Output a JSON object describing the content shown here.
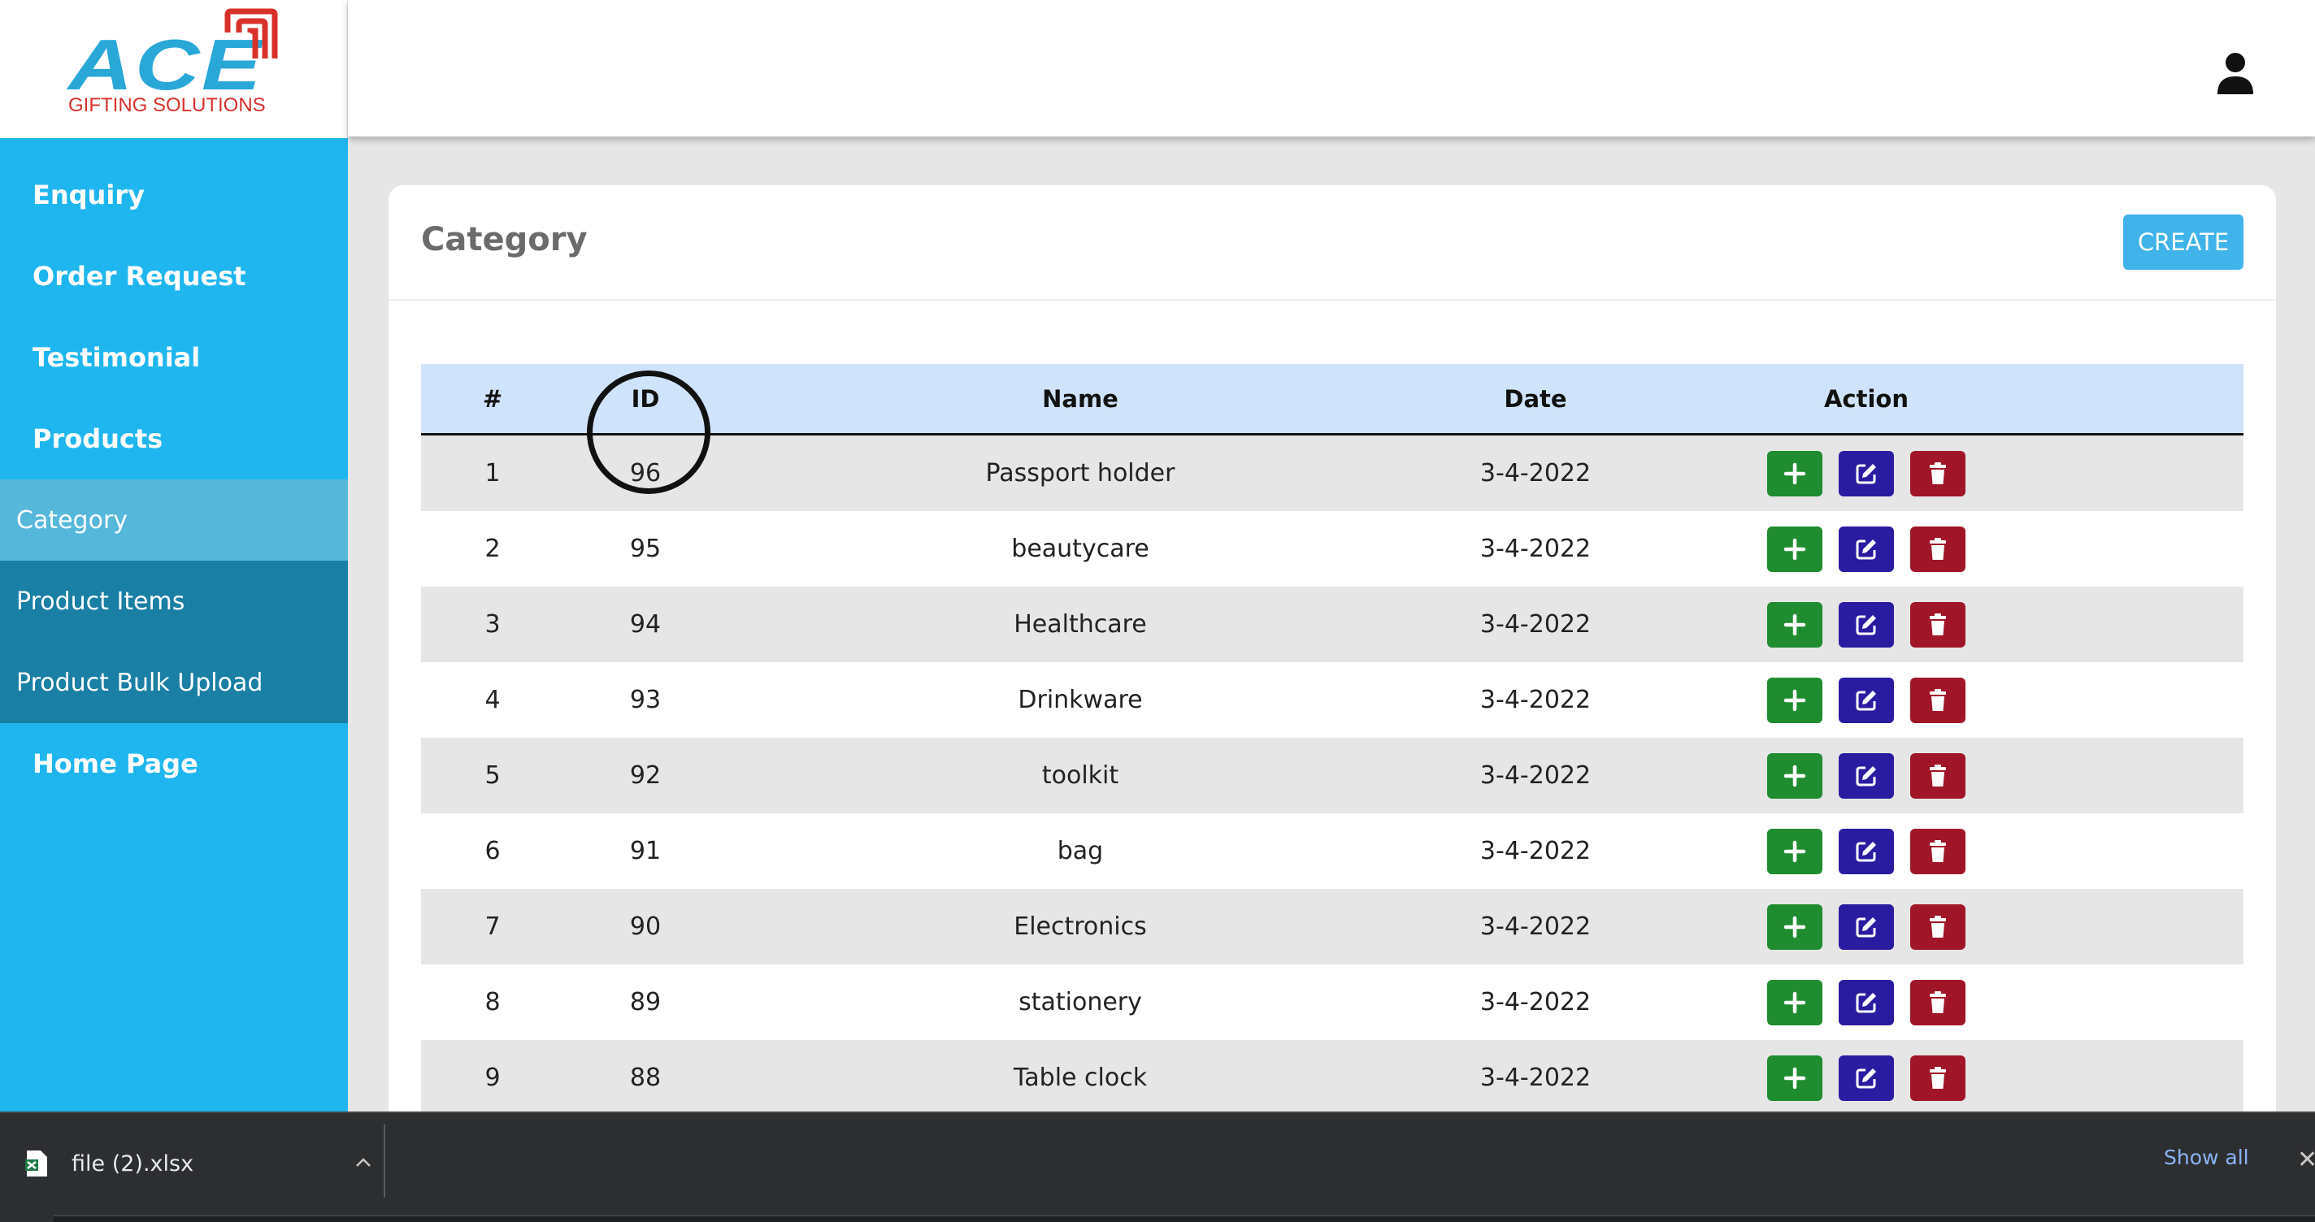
{
  "brand": {
    "logo_text": "ACE",
    "logo_subtitle": "GIFTING SOLUTIONS",
    "logo_color": "#29a8d8",
    "logo_accent": "#d8312a"
  },
  "sidebar": {
    "items": [
      {
        "label": "Enquiry"
      },
      {
        "label": "Order Request"
      },
      {
        "label": "Testimonial"
      },
      {
        "label": "Products"
      }
    ],
    "sub_items": [
      {
        "label": "Category",
        "active": true
      },
      {
        "label": "Product Items",
        "active": false
      },
      {
        "label": "Product Bulk Upload",
        "active": false
      }
    ],
    "bottom_item": {
      "label": "Home Page"
    },
    "color": "#1fb6ef"
  },
  "header": {
    "user_icon": "user-icon"
  },
  "main": {
    "title": "Category",
    "create_label": "CREATE",
    "table": {
      "headers": [
        "#",
        "ID",
        "Name",
        "Date",
        "Action"
      ],
      "rows": [
        {
          "num": "1",
          "id": "96",
          "name": "Passport holder",
          "date": "3-4-2022"
        },
        {
          "num": "2",
          "id": "95",
          "name": "beautycare",
          "date": "3-4-2022"
        },
        {
          "num": "3",
          "id": "94",
          "name": "Healthcare",
          "date": "3-4-2022"
        },
        {
          "num": "4",
          "id": "93",
          "name": "Drinkware",
          "date": "3-4-2022"
        },
        {
          "num": "5",
          "id": "92",
          "name": "toolkit",
          "date": "3-4-2022"
        },
        {
          "num": "6",
          "id": "91",
          "name": "bag",
          "date": "3-4-2022"
        },
        {
          "num": "7",
          "id": "90",
          "name": "Electronics",
          "date": "3-4-2022"
        },
        {
          "num": "8",
          "id": "89",
          "name": "stationery",
          "date": "3-4-2022"
        },
        {
          "num": "9",
          "id": "88",
          "name": "Table clock",
          "date": "3-4-2022"
        }
      ],
      "action_icons": [
        "plus-icon",
        "edit-icon",
        "trash-icon"
      ],
      "action_colors": {
        "add": "#1f8c2f",
        "edit": "#2a1ca0",
        "delete": "#a01628"
      }
    }
  },
  "downloads": {
    "file_name": "file (2).xlsx",
    "show_all_label": "Show all",
    "close_glyph": "✕"
  }
}
